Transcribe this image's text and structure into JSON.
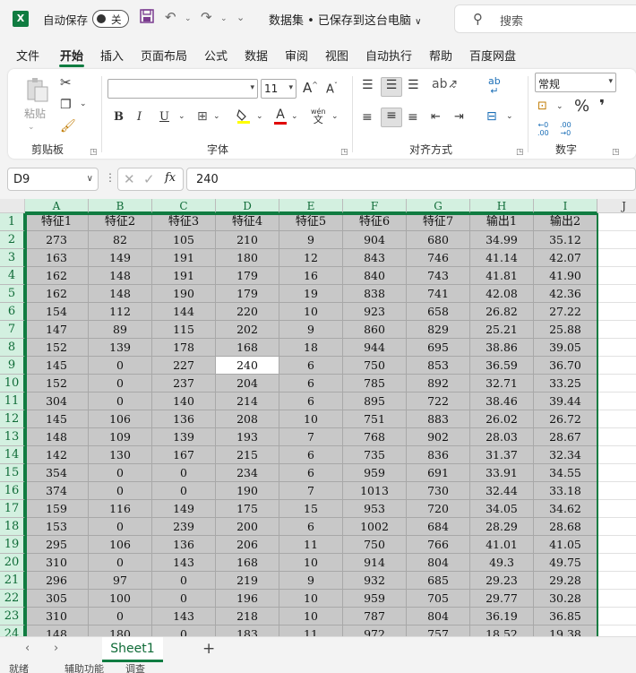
{
  "titlebar": {
    "autosave_label": "自动保存",
    "autosave_state": "关",
    "doc_title": "数据集 • 已保存到这台电脑",
    "search_placeholder": "搜索"
  },
  "tabs": [
    "文件",
    "开始",
    "插入",
    "页面布局",
    "公式",
    "数据",
    "审阅",
    "视图",
    "自动执行",
    "帮助",
    "百度网盘"
  ],
  "active_tab": "开始",
  "ribbon": {
    "paste_label": "粘贴",
    "clipboard_label": "剪贴板",
    "font_label": "字体",
    "font_name": "",
    "font_size": "11",
    "bold": "B",
    "italic": "I",
    "underline": "U",
    "align_label": "对齐方式",
    "number_label": "数字",
    "number_format": "常规",
    "percent": "%",
    "wen": "wén",
    "wen2": "文",
    "abc": "ab",
    "inc_a": "A",
    "dec_a": "A",
    "font_color_a": "A"
  },
  "formula_bar": {
    "name_box": "D9",
    "fx": "fx",
    "value": "240"
  },
  "columns": [
    "A",
    "B",
    "C",
    "D",
    "E",
    "F",
    "G",
    "H",
    "I",
    "J"
  ],
  "header_row": [
    "特征1",
    "特征2",
    "特征3",
    "特征4",
    "特征5",
    "特征6",
    "特征7",
    "输出1",
    "输出2"
  ],
  "rows": [
    [
      "273",
      "82",
      "105",
      "210",
      "9",
      "904",
      "680",
      "34.99",
      "35.12"
    ],
    [
      "163",
      "149",
      "191",
      "180",
      "12",
      "843",
      "746",
      "41.14",
      "42.07"
    ],
    [
      "162",
      "148",
      "191",
      "179",
      "16",
      "840",
      "743",
      "41.81",
      "41.90"
    ],
    [
      "162",
      "148",
      "190",
      "179",
      "19",
      "838",
      "741",
      "42.08",
      "42.36"
    ],
    [
      "154",
      "112",
      "144",
      "220",
      "10",
      "923",
      "658",
      "26.82",
      "27.22"
    ],
    [
      "147",
      "89",
      "115",
      "202",
      "9",
      "860",
      "829",
      "25.21",
      "25.88"
    ],
    [
      "152",
      "139",
      "178",
      "168",
      "18",
      "944",
      "695",
      "38.86",
      "39.05"
    ],
    [
      "145",
      "0",
      "227",
      "240",
      "6",
      "750",
      "853",
      "36.59",
      "36.70"
    ],
    [
      "152",
      "0",
      "237",
      "204",
      "6",
      "785",
      "892",
      "32.71",
      "33.25"
    ],
    [
      "304",
      "0",
      "140",
      "214",
      "6",
      "895",
      "722",
      "38.46",
      "39.44"
    ],
    [
      "145",
      "106",
      "136",
      "208",
      "10",
      "751",
      "883",
      "26.02",
      "26.72"
    ],
    [
      "148",
      "109",
      "139",
      "193",
      "7",
      "768",
      "902",
      "28.03",
      "28.67"
    ],
    [
      "142",
      "130",
      "167",
      "215",
      "6",
      "735",
      "836",
      "31.37",
      "32.34"
    ],
    [
      "354",
      "0",
      "0",
      "234",
      "6",
      "959",
      "691",
      "33.91",
      "34.55"
    ],
    [
      "374",
      "0",
      "0",
      "190",
      "7",
      "1013",
      "730",
      "32.44",
      "33.18"
    ],
    [
      "159",
      "116",
      "149",
      "175",
      "15",
      "953",
      "720",
      "34.05",
      "34.62"
    ],
    [
      "153",
      "0",
      "239",
      "200",
      "6",
      "1002",
      "684",
      "28.29",
      "28.68"
    ],
    [
      "295",
      "106",
      "136",
      "206",
      "11",
      "750",
      "766",
      "41.01",
      "41.05"
    ],
    [
      "310",
      "0",
      "143",
      "168",
      "10",
      "914",
      "804",
      "49.3",
      "49.75"
    ],
    [
      "296",
      "97",
      "0",
      "219",
      "9",
      "932",
      "685",
      "29.23",
      "29.28"
    ],
    [
      "305",
      "100",
      "0",
      "196",
      "10",
      "959",
      "705",
      "29.77",
      "30.28"
    ],
    [
      "310",
      "0",
      "143",
      "218",
      "10",
      "787",
      "804",
      "36.19",
      "36.85"
    ],
    [
      "148",
      "180",
      "0",
      "183",
      "11",
      "972",
      "757",
      "18.52",
      "19.38"
    ]
  ],
  "active_cell": {
    "row": 9,
    "col": "D"
  },
  "sheet_tabs": [
    "Sheet1"
  ],
  "add_sheet": "+",
  "status": {
    "ready": "就绪",
    "accessibility": "辅助功能",
    "other": "调查"
  },
  "colors": {
    "accent": "#107c41",
    "selection": "#c8c8c8"
  }
}
